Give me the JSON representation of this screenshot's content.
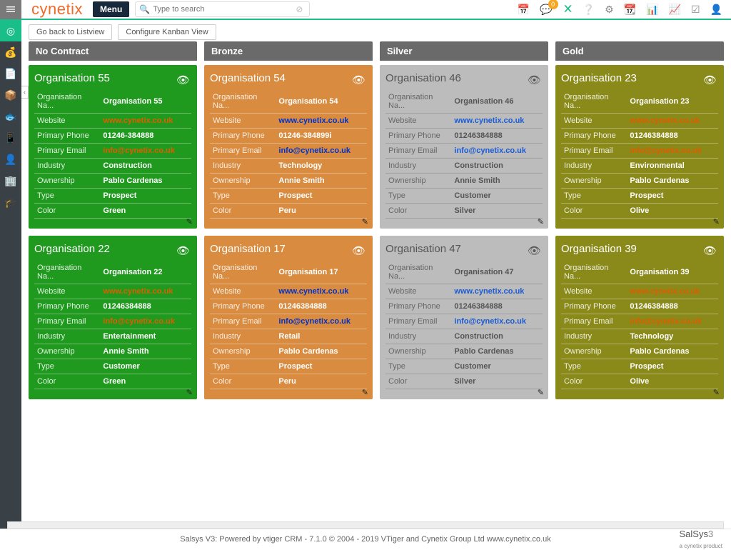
{
  "brand": "cynetix",
  "menu_label": "Menu",
  "search_placeholder": "Type to search",
  "notification_count": "0",
  "toolbar": {
    "back": "Go back to Listview",
    "config": "Configure Kanban View"
  },
  "fields": {
    "name": "Organisation Na...",
    "website": "Website",
    "phone": "Primary Phone",
    "email": "Primary Email",
    "industry": "Industry",
    "ownership": "Ownership",
    "type": "Type",
    "color": "Color"
  },
  "columns": [
    {
      "title": "No Contract",
      "style": "green",
      "cards": [
        {
          "title": "Organisation 55",
          "name": "Organisation 55",
          "website": "www.cynetix.co.uk",
          "website_style": "link-org",
          "phone": "01246-384888",
          "email": "info@cynetix.co.uk",
          "email_style": "link-org",
          "industry": "Construction",
          "ownership": "Pablo Cardenas",
          "type": "Prospect",
          "color": "Green"
        },
        {
          "title": "Organisation 22",
          "name": "Organisation 22",
          "website": "www.cynetix.co.uk",
          "website_style": "link-org",
          "phone": "01246384888",
          "email": "info@cynetix.co.uk",
          "email_style": "link-org",
          "industry": "Entertainment",
          "ownership": "Annie Smith",
          "type": "Customer",
          "color": "Green"
        }
      ]
    },
    {
      "title": "Bronze",
      "style": "orange",
      "cards": [
        {
          "title": "Organisation 54",
          "name": "Organisation 54",
          "website": "www.cynetix.co.uk",
          "website_style": "link-blue",
          "phone": "01246-384899i",
          "email": "info@cynetix.co.uk",
          "email_style": "link-blue",
          "industry": "Technology",
          "ownership": "Annie Smith",
          "type": "Prospect",
          "color": "Peru"
        },
        {
          "title": "Organisation 17",
          "name": "Organisation 17",
          "website": "www.cynetix.co.uk",
          "website_style": "link-blue",
          "phone": "01246384888",
          "email": "info@cynetix.co.uk",
          "email_style": "link-blue",
          "industry": "Retail",
          "ownership": "Pablo Cardenas",
          "type": "Prospect",
          "color": "Peru"
        }
      ]
    },
    {
      "title": "Silver",
      "style": "silver",
      "cards": [
        {
          "title": "Organisation 46",
          "name": "Organisation 46",
          "website": "www.cynetix.co.uk",
          "website_style": "link-blue",
          "phone": "01246384888",
          "email": "info@cynetix.co.uk",
          "email_style": "link-blue",
          "industry": "Construction",
          "ownership": "Annie Smith",
          "type": "Customer",
          "color": "Silver"
        },
        {
          "title": "Organisation 47",
          "name": "Organisation 47",
          "website": "www.cynetix.co.uk",
          "website_style": "link-blue",
          "phone": "01246384888",
          "email": "info@cynetix.co.uk",
          "email_style": "link-blue",
          "industry": "Construction",
          "ownership": "Pablo Cardenas",
          "type": "Customer",
          "color": "Silver"
        }
      ]
    },
    {
      "title": "Gold",
      "style": "olive",
      "cards": [
        {
          "title": "Organisation 23",
          "name": "Organisation 23",
          "website": "www.cynetix.co.uk",
          "website_style": "link-org",
          "phone": "01246384888",
          "email": "info@cynetix.co.uk",
          "email_style": "link-org",
          "industry": "Environmental",
          "ownership": "Pablo Cardenas",
          "type": "Prospect",
          "color": "Olive"
        },
        {
          "title": "Organisation 39",
          "name": "Organisation 39",
          "website": "www.cynetix.co.uk",
          "website_style": "link-org",
          "phone": "01246384888",
          "email": "info@cynetix.co.uk",
          "email_style": "link-org",
          "industry": "Technology",
          "ownership": "Pablo Cardenas",
          "type": "Prospect",
          "color": "Olive"
        }
      ]
    }
  ],
  "footer": {
    "text": "Salsys V3: Powered by vtiger CRM - 7.1.0 © 2004 - 2019 VTiger and Cynetix Group Ltd www.cynetix.co.uk",
    "brand_main": "SalSys",
    "brand_ver": "3",
    "brand_sub": "a cynetix product"
  }
}
